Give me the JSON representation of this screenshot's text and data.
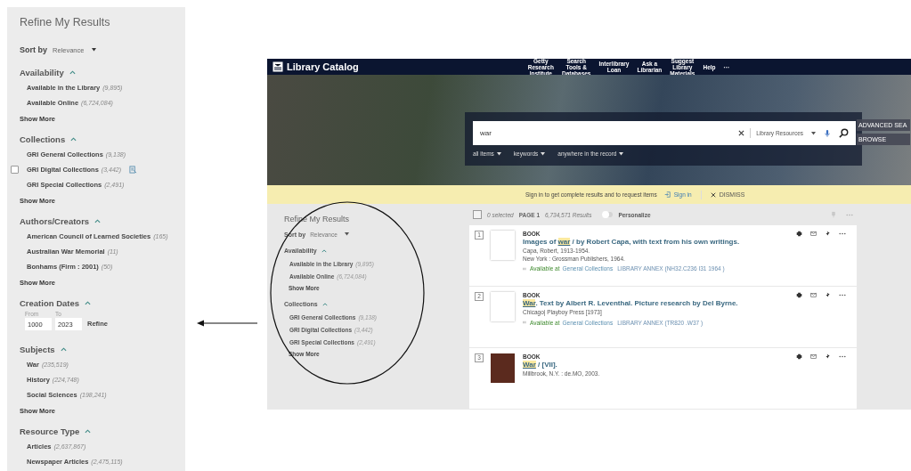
{
  "refine_panel": {
    "title": "Refine My Results",
    "sort": {
      "label": "Sort by",
      "value": "Relevance"
    },
    "sections": [
      {
        "kind": "list",
        "title": "Availability",
        "expanded": true,
        "items": [
          {
            "label": "Available in the Library",
            "count": "(9,895)",
            "hovered": false,
            "checked": false
          },
          {
            "label": "Available Online",
            "count": "(6,724,084)",
            "hovered": false,
            "checked": false
          }
        ],
        "show_more": "Show More"
      },
      {
        "kind": "list",
        "title": "Collections",
        "expanded": true,
        "items": [
          {
            "label": "GRI General Collections",
            "count": "(9,138)",
            "hovered": false,
            "checked": false
          },
          {
            "label": "GRI Digital Collections",
            "count": "(3,442)",
            "hovered": true,
            "checked": false
          },
          {
            "label": "GRI Special Collections",
            "count": "(2,491)",
            "hovered": false,
            "checked": false
          }
        ],
        "show_more": "Show More"
      },
      {
        "kind": "list",
        "title": "Authors/Creators",
        "expanded": true,
        "items": [
          {
            "label": "American Council of Learned Societies",
            "count": "(165)",
            "hovered": false,
            "checked": false
          },
          {
            "label": "Australian War Memorial",
            "count": "(11)",
            "hovered": false,
            "checked": false
          },
          {
            "label": "Bonhams (Firm : 2001)",
            "count": "(50)",
            "hovered": false,
            "checked": false
          }
        ],
        "show_more": "Show More"
      },
      {
        "kind": "dates",
        "title": "Creation Dates",
        "expanded": true,
        "from_label": "From",
        "to_label": "To",
        "from": "1000",
        "to": "2023",
        "button": "Refine"
      },
      {
        "kind": "list",
        "title": "Subjects",
        "expanded": true,
        "items": [
          {
            "label": "War",
            "count": "(235,519)",
            "hovered": false,
            "checked": false
          },
          {
            "label": "History",
            "count": "(224,748)",
            "hovered": false,
            "checked": false
          },
          {
            "label": "Social Sciences",
            "count": "(198,241)",
            "hovered": false,
            "checked": false
          }
        ],
        "show_more": "Show More"
      },
      {
        "kind": "list",
        "title": "Resource Type",
        "expanded": true,
        "items": [
          {
            "label": "Articles",
            "count": "(2,637,867)",
            "hovered": false,
            "checked": false
          },
          {
            "label": "Newspaper Articles",
            "count": "(2,475,115)",
            "hovered": false,
            "checked": false
          }
        ]
      }
    ]
  },
  "catalog": {
    "logo": "Library Catalog",
    "nav": [
      [
        "Getty",
        "Research",
        "Institute"
      ],
      [
        "Search",
        "Tools &",
        "Databases"
      ],
      [
        "Interlibrary",
        "Loan"
      ],
      [
        "Ask a",
        "Librarian"
      ],
      [
        "Suggest",
        "Library",
        "Materials"
      ],
      [
        "Help"
      ],
      [
        "···"
      ]
    ],
    "search": {
      "value": "war",
      "scope": "Library Resources"
    },
    "filters": [
      "all items",
      "keywords",
      "anywhere in the record"
    ],
    "side_buttons": [
      "ADVANCED SEA",
      "BROWSE"
    ],
    "banner": {
      "text": "Sign in to get complete results and to request items",
      "sign_in": "Sign in",
      "dismiss": "DISMISS"
    },
    "sidebar": {
      "title": "Refine My Results",
      "sort": {
        "label": "Sort by",
        "value": "Relevance"
      },
      "sections": [
        {
          "title": "Availability",
          "expanded": true,
          "items": [
            {
              "label": "Available in the Library",
              "count": "(9,895)"
            },
            {
              "label": "Available Online",
              "count": "(6,724,084)"
            }
          ],
          "show_more": "Show More"
        },
        {
          "title": "Collections",
          "expanded": true,
          "items": [
            {
              "label": "GRI General Collections",
              "count": "(9,138)"
            },
            {
              "label": "GRI Digital Collections",
              "count": "(3,442)"
            },
            {
              "label": "GRI Special Collections",
              "count": "(2,491)"
            }
          ],
          "show_more": "Show More"
        }
      ]
    },
    "results_bar": {
      "all_selected": false,
      "selected": "0 selected",
      "page": "PAGE 1",
      "count": "6,734,571 Results",
      "personalize": {
        "label": "Personalize",
        "on": false
      }
    },
    "results": [
      {
        "number": "1",
        "dark_cover": false,
        "type": "BOOK",
        "title_before": "Images of ",
        "highlight": "war",
        "title_after": " / by Robert Capa, with text from his own writings.",
        "lines": [
          "Capa, Robert, 1913-1954.",
          "New York : Grossman Publishers, 1964."
        ],
        "availability": {
          "status": "Available at",
          "location": "General Collections",
          "shelf": "LIBRARY ANNEX (NH32.C236 I31 1964 )"
        }
      },
      {
        "number": "2",
        "dark_cover": false,
        "type": "BOOK",
        "highlight": "War",
        "title_after": ". Text by Albert R. Leventhal. Picture research by Del Byrne.",
        "lines": [
          "Chicago| Playboy Press [1973]"
        ],
        "availability": {
          "status": "Available at",
          "location": "General Collections",
          "shelf": "LIBRARY ANNEX (TR820 .W37 )"
        }
      },
      {
        "number": "3",
        "dark_cover": true,
        "type": "BOOK",
        "highlight": "War",
        "title_after": " / [VII].",
        "lines": [
          "Millbrook, N.Y. : de.MO, 2003."
        ]
      }
    ]
  }
}
